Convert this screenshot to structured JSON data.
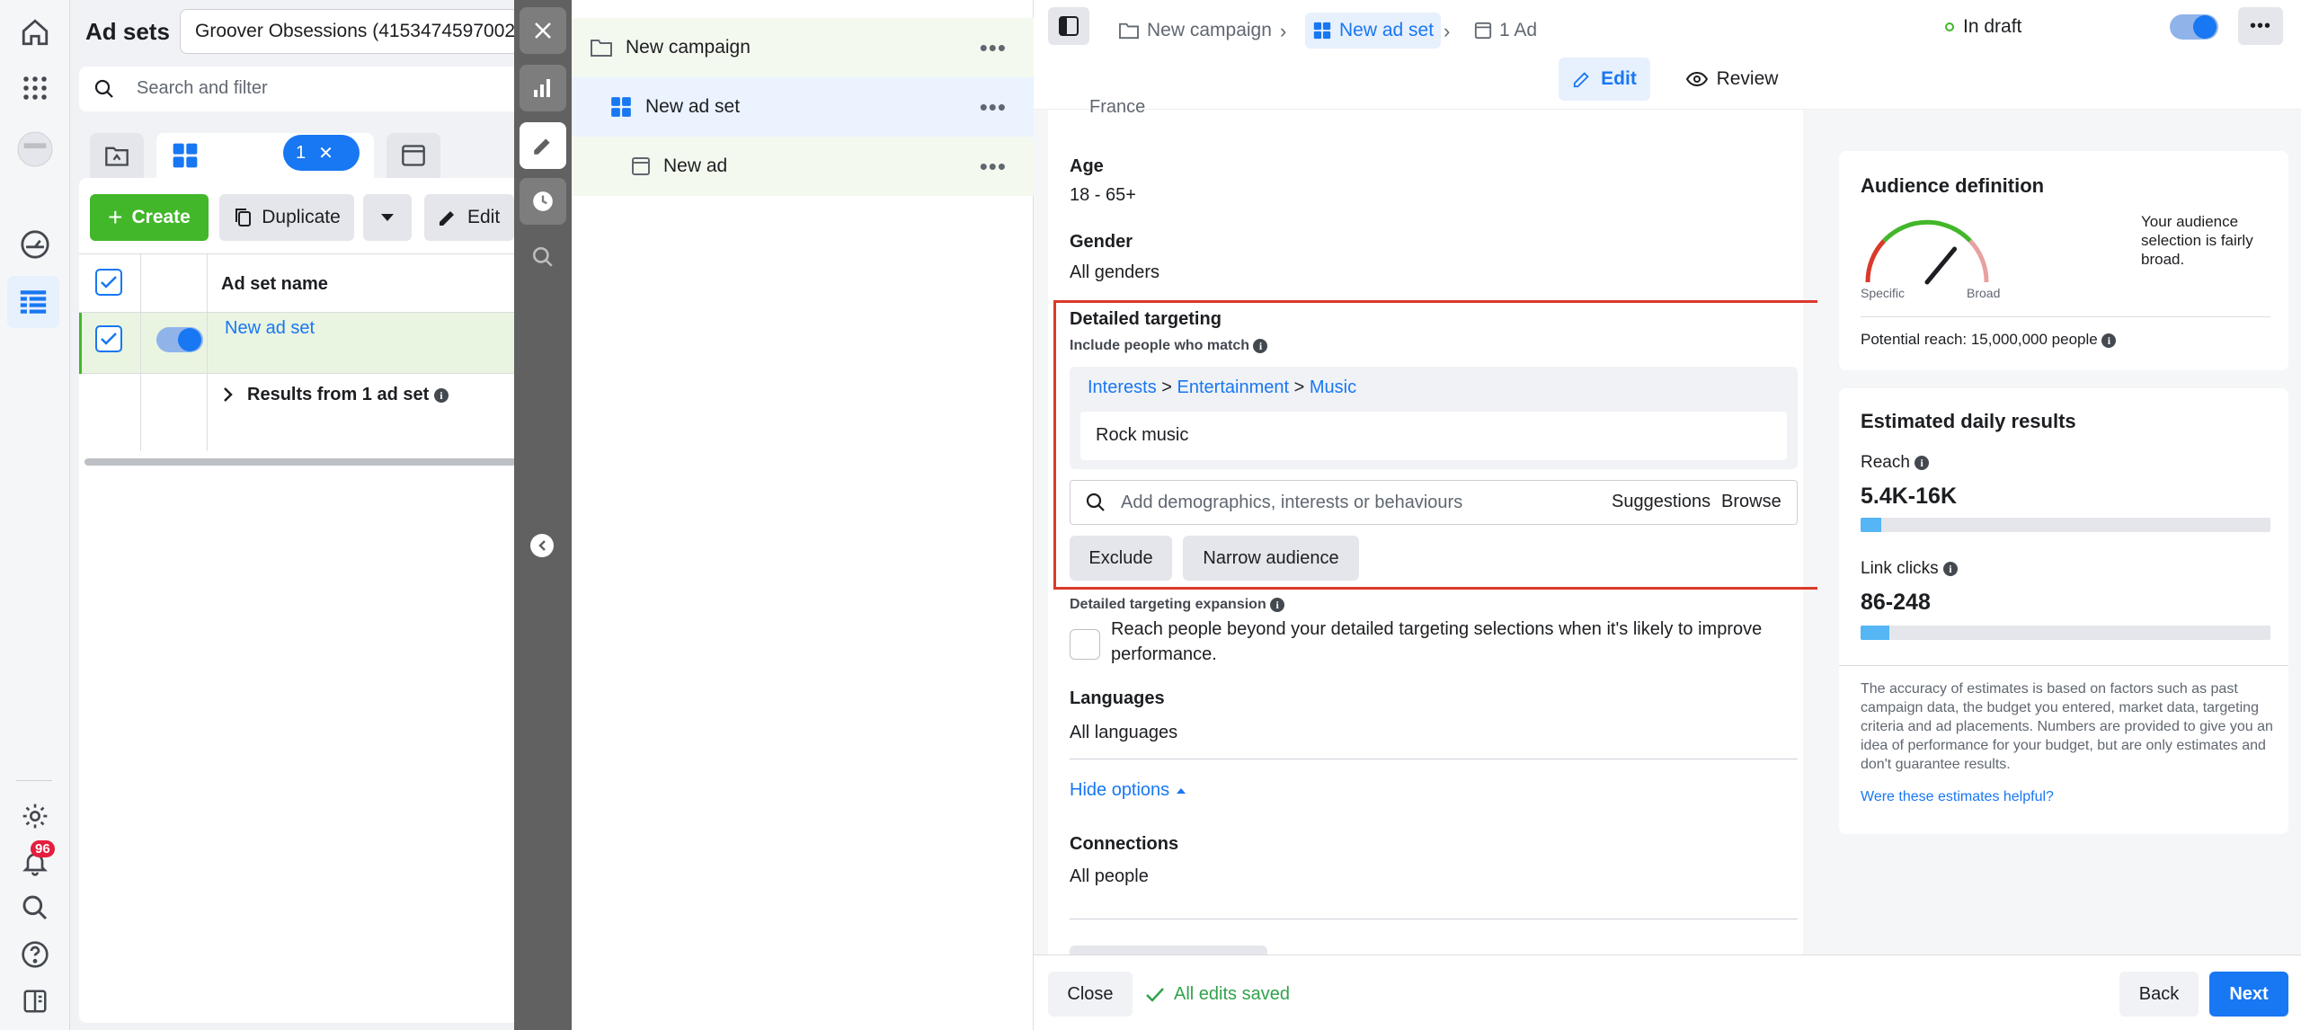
{
  "leftpanel": {
    "title": "Ad sets",
    "account": "Groover Obsessions (4153474597002...",
    "search_placeholder": "Search and filter",
    "selected_count": "1",
    "create": "Create",
    "duplicate": "Duplicate",
    "edit": "Edit",
    "column_header": "Ad set name",
    "row_name": "New ad set",
    "results_row": "Results from 1 ad set"
  },
  "rail": {
    "notification_count": "96"
  },
  "tree": {
    "campaign": "New campaign",
    "adset": "New ad set",
    "ad": "New ad"
  },
  "header": {
    "crumb_campaign": "New campaign",
    "crumb_adset": "New ad set",
    "crumb_ad": "1 Ad",
    "status": "In draft",
    "edit_tab": "Edit",
    "review_tab": "Review"
  },
  "form": {
    "location_cut": "France",
    "age_label": "Age",
    "age_value": "18 - 65+",
    "gender_label": "Gender",
    "gender_value": "All genders",
    "dt_title": "Detailed targeting",
    "dt_include": "Include people who match",
    "path_interests": "Interests",
    "path_entertainment": "Entertainment",
    "path_music": "Music",
    "path_sep": ">",
    "selected_interest": "Rock music",
    "dt_search_placeholder": "Add demographics, interests or behaviours",
    "suggestions": "Suggestions",
    "browse": "Browse",
    "exclude": "Exclude",
    "narrow": "Narrow audience",
    "expansion_title": "Detailed targeting expansion",
    "expansion_text": "Reach people beyond your detailed targeting selections when it's likely to improve performance.",
    "languages_label": "Languages",
    "languages_value": "All languages",
    "hide_options": "Hide options",
    "connections_label": "Connections",
    "connections_value": "All people"
  },
  "audience": {
    "title": "Audience definition",
    "gauge_specific": "Specific",
    "gauge_broad": "Broad",
    "gauge_level": 0.72,
    "description": "Your audience selection is fairly broad.",
    "potential_reach": "Potential reach: 15,000,000 people"
  },
  "estimates": {
    "title": "Estimated daily results",
    "reach_label": "Reach",
    "reach_value": "5.4K-16K",
    "reach_fill": 0.05,
    "clicks_label": "Link clicks",
    "clicks_value": "86-248",
    "clicks_fill": 0.07,
    "disclaimer": "The accuracy of estimates is based on factors such as past campaign data, the budget you entered, market data, targeting criteria and ad placements. Numbers are provided to give you an idea of performance for your budget, but are only estimates and don't guarantee results.",
    "helpful_link": "Were these estimates helpful?"
  },
  "footer": {
    "close": "Close",
    "saved": "All edits saved",
    "back": "Back",
    "next": "Next"
  },
  "colors": {
    "accent": "#1877f2",
    "create_green": "#42b72a",
    "highlight_red": "#d93a2b",
    "saved_green": "#31a24c"
  }
}
